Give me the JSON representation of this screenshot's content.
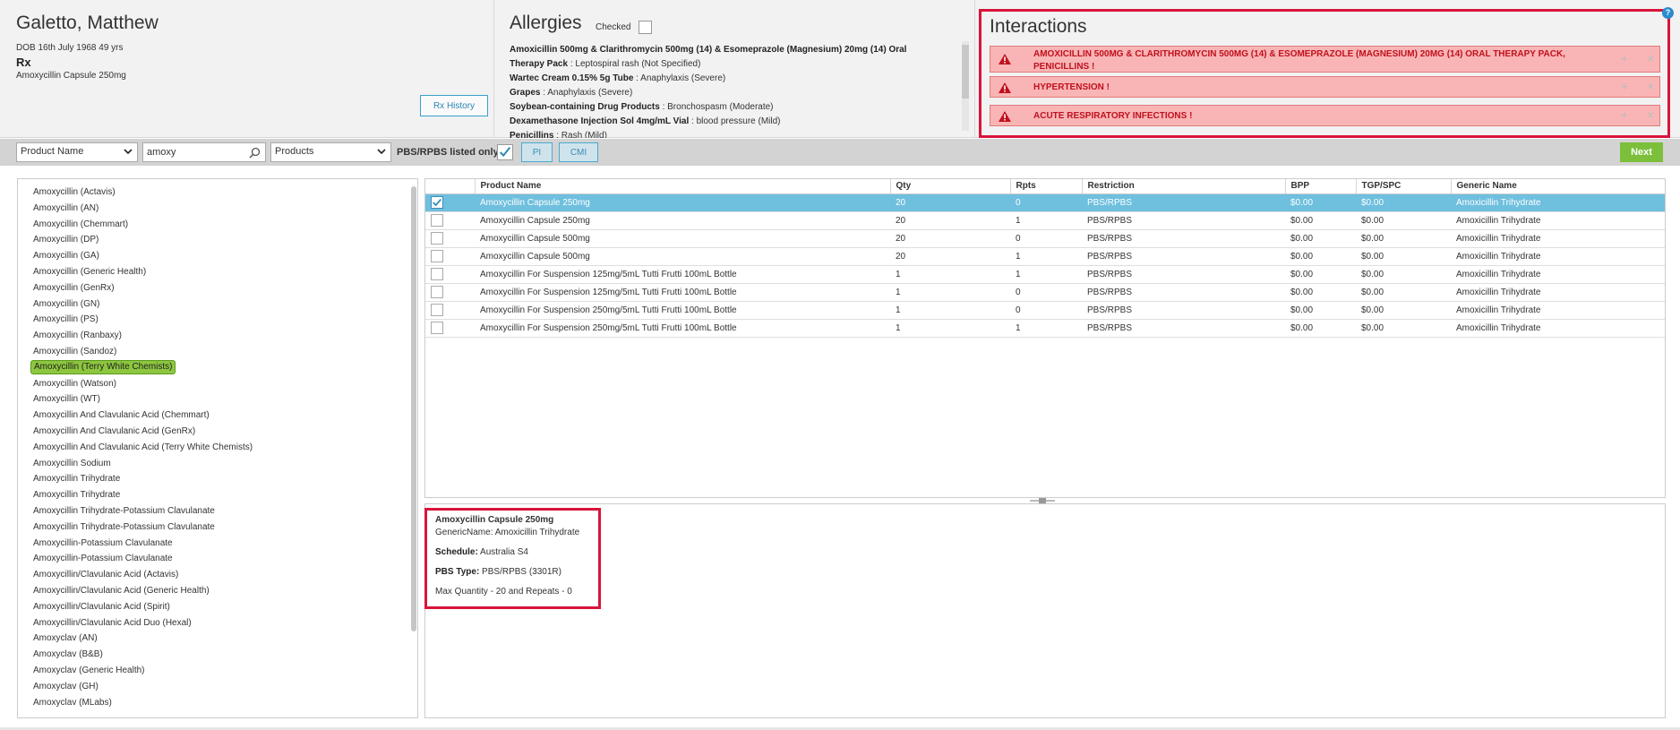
{
  "patient": {
    "name": "Galetto, Matthew",
    "dob": "DOB 16th July 1968 49 yrs",
    "rx_label": "Rx",
    "rx_drug": "Amoxycillin Capsule 250mg",
    "rx_history_button": "Rx History"
  },
  "allergies": {
    "title": "Allergies",
    "checked_label": "Checked",
    "items": [
      {
        "name": "Amoxicillin 500mg & Clarithromycin 500mg (14) & Esomeprazole (Magnesium) 20mg (14) Oral",
        "reaction": ""
      },
      {
        "name": "Therapy Pack",
        "reaction": " : Leptospiral rash (Not Specified)"
      },
      {
        "name": "Wartec Cream 0.15% 5g Tube",
        "reaction": " : Anaphylaxis (Severe)"
      },
      {
        "name": "Grapes",
        "reaction": " : Anaphylaxis (Severe)"
      },
      {
        "name": "Soybean-containing Drug Products",
        "reaction": " : Bronchospasm (Moderate)"
      },
      {
        "name": "Dexamethasone Injection Sol 4mg/mL Vial",
        "reaction": " : blood pressure (Mild)"
      },
      {
        "name": "Penicillins",
        "reaction": " : Rash (Mild)"
      }
    ]
  },
  "interactions": {
    "title": "Interactions",
    "items": [
      {
        "text": "AMOXICILLIN 500MG & CLARITHROMYCIN 500MG (14) & ESOMEPRAZOLE (MAGNESIUM) 20MG (14) ORAL THERAPY PACK, PENICILLINS !"
      },
      {
        "text": "HYPERTENSION !"
      },
      {
        "text": "ACUTE RESPIRATORY INFECTIONS !"
      }
    ],
    "plus_glyph": "+",
    "close_glyph": "×"
  },
  "help_glyph": "?",
  "toolbar": {
    "search_by": "Product Name",
    "search_value": "amoxy",
    "category": "Products",
    "pbs_label": "PBS/RPBS listed only",
    "pi_button": "PI",
    "cmi_button": "CMI",
    "next_button": "Next"
  },
  "left_list": [
    "Amoxycillin (Actavis)",
    "Amoxycillin (AN)",
    "Amoxycillin (Chemmart)",
    "Amoxycillin (DP)",
    "Amoxycillin (GA)",
    "Amoxycillin (Generic Health)",
    "Amoxycillin (GenRx)",
    "Amoxycillin (GN)",
    "Amoxycillin (PS)",
    "Amoxycillin (Ranbaxy)",
    "Amoxycillin (Sandoz)",
    "Amoxycillin (Terry White Chemists)",
    "Amoxycillin (Watson)",
    "Amoxycillin (WT)",
    "Amoxycillin And Clavulanic Acid (Chemmart)",
    "Amoxycillin And Clavulanic Acid (GenRx)",
    "Amoxycillin And Clavulanic Acid (Terry White Chemists)",
    "Amoxycillin Sodium",
    "Amoxycillin Trihydrate",
    "Amoxycillin Trihydrate",
    "Amoxycillin Trihydrate-Potassium Clavulanate",
    "Amoxycillin Trihydrate-Potassium Clavulanate",
    "Amoxycillin-Potassium Clavulanate",
    "Amoxycillin-Potassium Clavulanate",
    "Amoxycillin/Clavulanic Acid (Actavis)",
    "Amoxycillin/Clavulanic Acid (Generic Health)",
    "Amoxycillin/Clavulanic Acid (Spirit)",
    "Amoxycillin/Clavulanic Acid Duo (Hexal)",
    "Amoxyclav (AN)",
    "Amoxyclav (B&B)",
    "Amoxyclav (Generic Health)",
    "Amoxyclav (GH)",
    "Amoxyclav (MLabs)"
  ],
  "table": {
    "columns": [
      "Product Name",
      "Qty",
      "Rpts",
      "Restriction",
      "BPP",
      "TGP/SPC",
      "Generic Name"
    ],
    "rows": [
      {
        "name": "Amoxycillin Capsule 250mg",
        "qty": "20",
        "rpts": "0",
        "restriction": "PBS/RPBS",
        "bpp": "$0.00",
        "tgp": "$0.00",
        "generic": "Amoxicillin Trihydrate"
      },
      {
        "name": "Amoxycillin Capsule 250mg",
        "qty": "20",
        "rpts": "1",
        "restriction": "PBS/RPBS",
        "bpp": "$0.00",
        "tgp": "$0.00",
        "generic": "Amoxicillin Trihydrate"
      },
      {
        "name": "Amoxycillin Capsule 500mg",
        "qty": "20",
        "rpts": "0",
        "restriction": "PBS/RPBS",
        "bpp": "$0.00",
        "tgp": "$0.00",
        "generic": "Amoxicillin Trihydrate"
      },
      {
        "name": "Amoxycillin Capsule 500mg",
        "qty": "20",
        "rpts": "1",
        "restriction": "PBS/RPBS",
        "bpp": "$0.00",
        "tgp": "$0.00",
        "generic": "Amoxicillin Trihydrate"
      },
      {
        "name": "Amoxycillin For Suspension 125mg/5mL Tutti Frutti 100mL Bottle",
        "qty": "1",
        "rpts": "1",
        "restriction": "PBS/RPBS",
        "bpp": "$0.00",
        "tgp": "$0.00",
        "generic": "Amoxicillin Trihydrate"
      },
      {
        "name": "Amoxycillin For Suspension 125mg/5mL Tutti Frutti 100mL Bottle",
        "qty": "1",
        "rpts": "0",
        "restriction": "PBS/RPBS",
        "bpp": "$0.00",
        "tgp": "$0.00",
        "generic": "Amoxicillin Trihydrate"
      },
      {
        "name": "Amoxycillin For Suspension 250mg/5mL Tutti Frutti 100mL Bottle",
        "qty": "1",
        "rpts": "0",
        "restriction": "PBS/RPBS",
        "bpp": "$0.00",
        "tgp": "$0.00",
        "generic": "Amoxicillin Trihydrate"
      },
      {
        "name": "Amoxycillin For Suspension 250mg/5mL Tutti Frutti 100mL Bottle",
        "qty": "1",
        "rpts": "1",
        "restriction": "PBS/RPBS",
        "bpp": "$0.00",
        "tgp": "$0.00",
        "generic": "Amoxicillin Trihydrate"
      }
    ]
  },
  "details": {
    "title": "Amoxycillin Capsule 250mg",
    "generic_line": "GenericName: Amoxicillin Trihydrate",
    "schedule_label": "Schedule:",
    "schedule_value": " Australia S4",
    "pbs_label": "PBS Type:",
    "pbs_value": " PBS/RPBS (3301R)",
    "max_line": "Max Quantity - 20 and Repeats - 0"
  },
  "colors": {
    "alert_border": "#d8143a",
    "alert_bg": "#f9b5b5",
    "alert_text": "#c0101e",
    "row_selected": "#6fbfde",
    "list_selected": "#8dc63f",
    "next_button": "#7bbf3b",
    "accent": "#3ba1c9"
  }
}
